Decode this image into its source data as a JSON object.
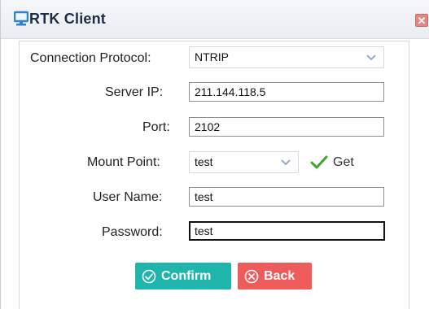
{
  "window": {
    "title": "RTK Client",
    "close_glyph": "✕",
    "title_icon": "monitor-icon"
  },
  "form": {
    "connection_protocol": {
      "label": "Connection Protocol:",
      "value": "NTRIP"
    },
    "server_ip": {
      "label": "Server IP:",
      "value": "211.144.118.5"
    },
    "port": {
      "label": "Port:",
      "value": "2102"
    },
    "mount_point": {
      "label": "Mount Point:",
      "value": "test",
      "get_label": "Get"
    },
    "user_name": {
      "label": "User Name:",
      "value": "test"
    },
    "password": {
      "label": "Password:",
      "value": "test"
    }
  },
  "buttons": {
    "confirm_label": "Confirm",
    "back_label": "Back"
  },
  "colors": {
    "confirm": "#1fb5ad",
    "back": "#ed5b5b",
    "title_icon": "#2a83d6",
    "get_check": "#3fa52f"
  }
}
